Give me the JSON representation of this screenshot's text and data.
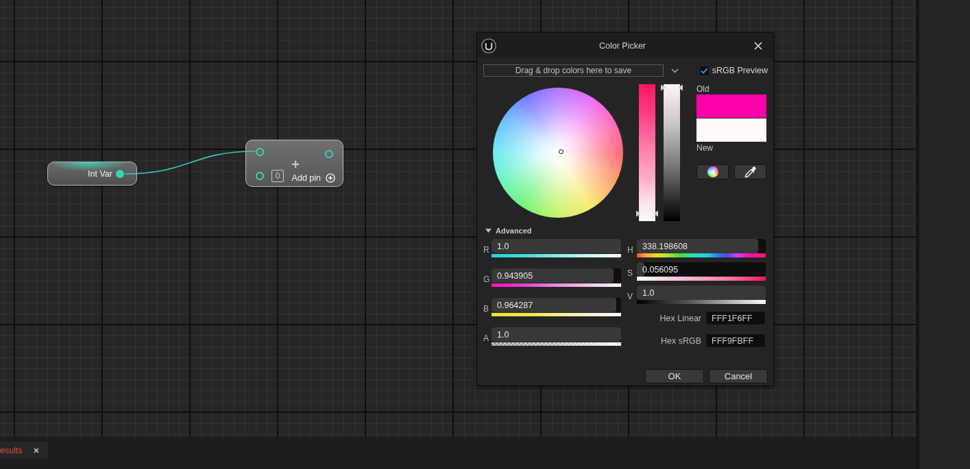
{
  "graph": {
    "nodes": [
      {
        "kind": "variable",
        "title": "Int Var",
        "outputs": [
          {
            "filled": true
          }
        ]
      },
      {
        "kind": "compact",
        "title": "+",
        "inputs": [
          {
            "filled": false
          },
          {
            "filled": false,
            "default_value": "0"
          }
        ],
        "outputs": [
          {
            "filled": false
          }
        ],
        "add_pin": "Add pin"
      }
    ]
  },
  "color_picker": {
    "title": "Color Picker",
    "saved_colors": {
      "placeholder": "Drag & drop colors here to save"
    },
    "srgb_preview": {
      "label": "sRGB Preview",
      "checked": true
    },
    "sliders": [
      {
        "kind": "saturation",
        "level": 0.056095
      },
      {
        "kind": "value",
        "level": 1.0
      }
    ],
    "swatches": [
      {
        "label": "Old",
        "color": "#ff00aa"
      },
      {
        "label": "New",
        "color": "#fff9fb"
      }
    ],
    "advanced": {
      "label": "Advanced",
      "expanded": true,
      "rgba": [
        {
          "kind": "red",
          "label": "R",
          "value": "1.0",
          "level": 1.0
        },
        {
          "kind": "green",
          "label": "G",
          "value": "0.943905",
          "level": 0.943905
        },
        {
          "kind": "blue",
          "label": "B",
          "value": "0.964287",
          "level": 0.964287
        },
        {
          "kind": "alpha",
          "label": "A",
          "value": "1.0",
          "level": 1.0
        }
      ],
      "hsv": [
        {
          "kind": "hue",
          "label": "H",
          "value": "338.198608",
          "level": 0.939441
        },
        {
          "kind": "saturation",
          "label": "S",
          "value": "0.056095",
          "level": 0.056095
        },
        {
          "kind": "value",
          "label": "V",
          "value": "1.0",
          "level": 1.0
        }
      ],
      "hex": [
        {
          "label": "Hex Linear",
          "value": "FFF1F6FF"
        },
        {
          "label": "Hex sRGB",
          "value": "FFF9FBFF"
        }
      ]
    },
    "buttons": [
      {
        "label": "OK"
      },
      {
        "label": "Cancel"
      }
    ]
  },
  "bottom_tabs": [
    {
      "label": "esults",
      "selected": true
    }
  ]
}
